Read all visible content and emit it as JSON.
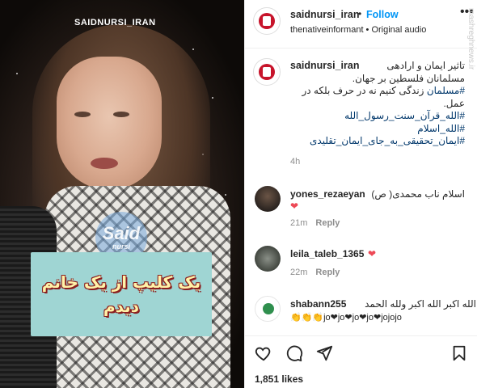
{
  "media": {
    "brand": "SAIDNURSI_IRAN",
    "watermark_big": "Said",
    "watermark_small": "nursi",
    "caption_line1": "یک کلیپ از یک خانم",
    "caption_line2": "دیدم"
  },
  "header": {
    "username": "saidnursi_iran",
    "dot": "•",
    "follow_label": "Follow",
    "subtitle": "thenativeinformant • Original audio",
    "more_icon": "more-dots-icon"
  },
  "post": {
    "username": "saidnursi_iran",
    "caption_line1": "تاثیر ایمان و ارادهی",
    "caption_line2": "مسلمانان فلسطین بر جهان.",
    "caption_tag1": "#مسلمان",
    "caption_line3": "زندگی کنیم نه در حرف بلکه در",
    "caption_line4": "عمل.",
    "tag2": "#الله_قرآن_سنت_رسول_الله",
    "tag3": "#الله_اسلام",
    "tag4": "#ایمان_تحقیقی_به_جای_ایمان_تقلیدی",
    "time": "4h"
  },
  "comments": [
    {
      "username": "yones_rezaeyan",
      "text": "اسلام ناب محمدی( ص)",
      "heart": "❤",
      "time": "21m",
      "reply_label": "Reply"
    },
    {
      "username": "leila_taleb_1365",
      "heart": "❤",
      "time": "22m",
      "reply_label": "Reply"
    },
    {
      "username": "shabann255",
      "text": "الله اکبر الله اکبر ولله الحمد",
      "emoji_line": "👏👏👏jo❤jo❤jo❤jo❤jojojo"
    }
  ],
  "footer": {
    "likes": "1,851 likes"
  },
  "side_watermark": "mashreghnews.ir",
  "colors": {
    "accent": "#0095f6",
    "heart": "#ed4956",
    "tag": "#00376b",
    "muted": "#8e8e8e"
  }
}
